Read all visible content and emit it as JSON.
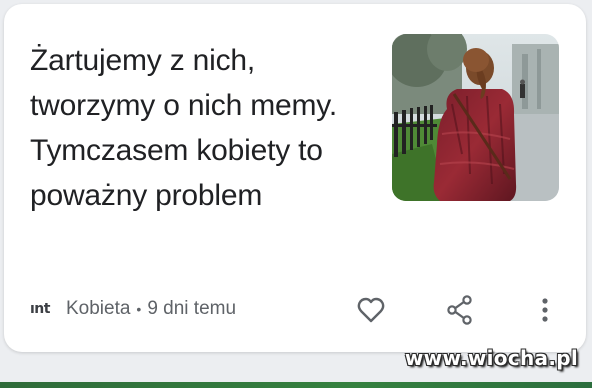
{
  "card": {
    "headline": "Żartujemy z nich, tworzymy o nich memy. Tymczasem kobiety to poważny problem",
    "source_logo": "ınt",
    "source_name": "Kobieta",
    "separator": "•",
    "time_ago": "9 dni temu",
    "thumbnail_icon": "photo-woman-red-sweater",
    "actions": {
      "like_icon": "heart-outline-icon",
      "share_icon": "share-icon",
      "more_icon": "more-vert-icon"
    }
  },
  "watermark": "www.wiocha.pl",
  "colors": {
    "text_primary": "#202124",
    "text_secondary": "#5f6368",
    "card_bg": "#ffffff",
    "page_bg": "#eceef1"
  }
}
